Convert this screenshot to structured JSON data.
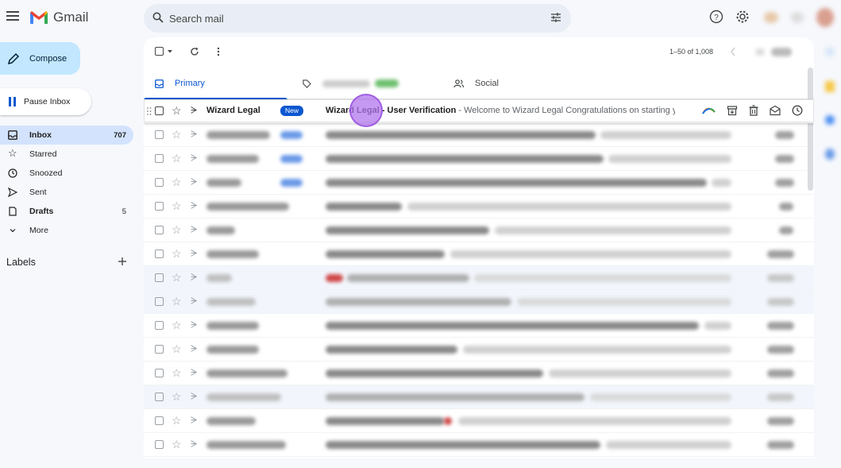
{
  "app": {
    "name": "Gmail",
    "accent": "#0b57d0"
  },
  "search": {
    "placeholder": "Search mail"
  },
  "sidebar": {
    "compose_label": "Compose",
    "pause_label": "Pause Inbox",
    "items": [
      {
        "label": "Inbox",
        "count": "707",
        "icon": "inbox-icon"
      },
      {
        "label": "Starred",
        "count": "",
        "icon": "star-icon"
      },
      {
        "label": "Snoozed",
        "count": "",
        "icon": "clock-icon"
      },
      {
        "label": "Sent",
        "count": "",
        "icon": "send-icon"
      },
      {
        "label": "Drafts",
        "count": "5",
        "icon": "draft-icon"
      },
      {
        "label": "More",
        "count": "",
        "icon": "chevron-down-icon"
      }
    ],
    "labels_title": "Labels"
  },
  "toolbar": {
    "pagination": "1–50 of 1,008"
  },
  "tabs": [
    {
      "label": "Primary",
      "icon": "inbox-icon"
    },
    {
      "label": "Social",
      "icon": "people-icon"
    }
  ],
  "first_email": {
    "sender": "Wizard Legal",
    "badge": "New",
    "subject": "Wizard Legal - User Verification",
    "snippet": " - Welcome to Wizard Legal Congratulations on starting y..."
  }
}
